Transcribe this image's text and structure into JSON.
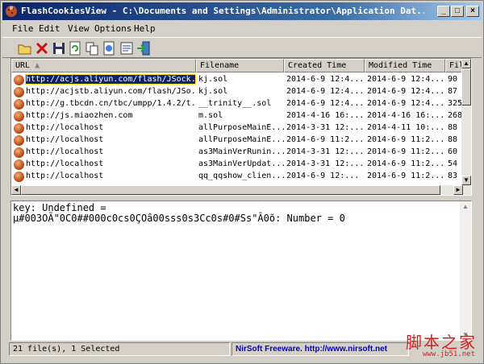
{
  "window": {
    "title": "FlashCookiesView  -  C:\\Documents and Settings\\Administrator\\Application Dat...",
    "controls": {
      "minimize": "_",
      "maximize": "□",
      "close": "×"
    }
  },
  "menu": [
    "File",
    "Edit",
    "View",
    "Options",
    "Help"
  ],
  "toolbar": {
    "icons": [
      "open-folder-icon",
      "delete-icon",
      "save-icon",
      "refresh-icon",
      "copy-icon",
      "html-report-icon",
      "properties-icon",
      "exit-icon"
    ]
  },
  "list": {
    "columns": [
      "URL",
      "Filename",
      "Created Time",
      "Modified Time",
      "Fil"
    ],
    "rows": [
      {
        "url": "http://acjs.aliyun.com/flash/JSock...",
        "filename": "kj.sol",
        "created": "2014-6-9 12:4...",
        "modified": "2014-6-9 12:4...",
        "size": "90",
        "selected": true
      },
      {
        "url": "http://acjstb.aliyun.com/flash/JSo...",
        "filename": "kj.sol",
        "created": "2014-6-9 12:4...",
        "modified": "2014-6-9 12:4...",
        "size": "87"
      },
      {
        "url": "http://g.tbcdn.cn/tbc/umpp/1.4.2/t...",
        "filename": "__trinity__.sol",
        "created": "2014-6-9 12:4...",
        "modified": "2014-6-9 12:4...",
        "size": "325"
      },
      {
        "url": "http://js.miaozhen.com",
        "filename": "m.sol",
        "created": "2014-4-16 16:...",
        "modified": "2014-4-16 16:...",
        "size": "268"
      },
      {
        "url": "http://localhost",
        "filename": "allPurposeMainE...",
        "created": "2014-3-31 12:...",
        "modified": "2014-4-11 10:...",
        "size": "88"
      },
      {
        "url": "http://localhost",
        "filename": "allPurposeMainE...",
        "created": "2014-6-9 11:2...",
        "modified": "2014-6-9 11:2...",
        "size": "88"
      },
      {
        "url": "http://localhost",
        "filename": "as3MainVerRunin...",
        "created": "2014-3-31 12:...",
        "modified": "2014-6-9 11:2...",
        "size": "60"
      },
      {
        "url": "http://localhost",
        "filename": "as3MainVerUpdat...",
        "created": "2014-3-31 12:...",
        "modified": "2014-6-9 11:2...",
        "size": "54"
      },
      {
        "url": "http://localhost",
        "filename": "qq_qqshow_clien...",
        "created": "2014-6-9 12:...",
        "modified": "2014-6-9 11:2...",
        "size": "83"
      }
    ]
  },
  "detail": {
    "line1": "key: Undefined =",
    "line2": "µ#003OÃ\"0C0##000c0cs0ÇOâ00sss0s3Cc0s#0#Ss\"Â0õ: Number = 0"
  },
  "status": {
    "count": "21 file(s), 1 Selected",
    "credit": "NirSoft Freeware.  http://www.nirsoft.net"
  },
  "watermark": {
    "text": "脚本之家",
    "url": "www.jb51.net"
  }
}
